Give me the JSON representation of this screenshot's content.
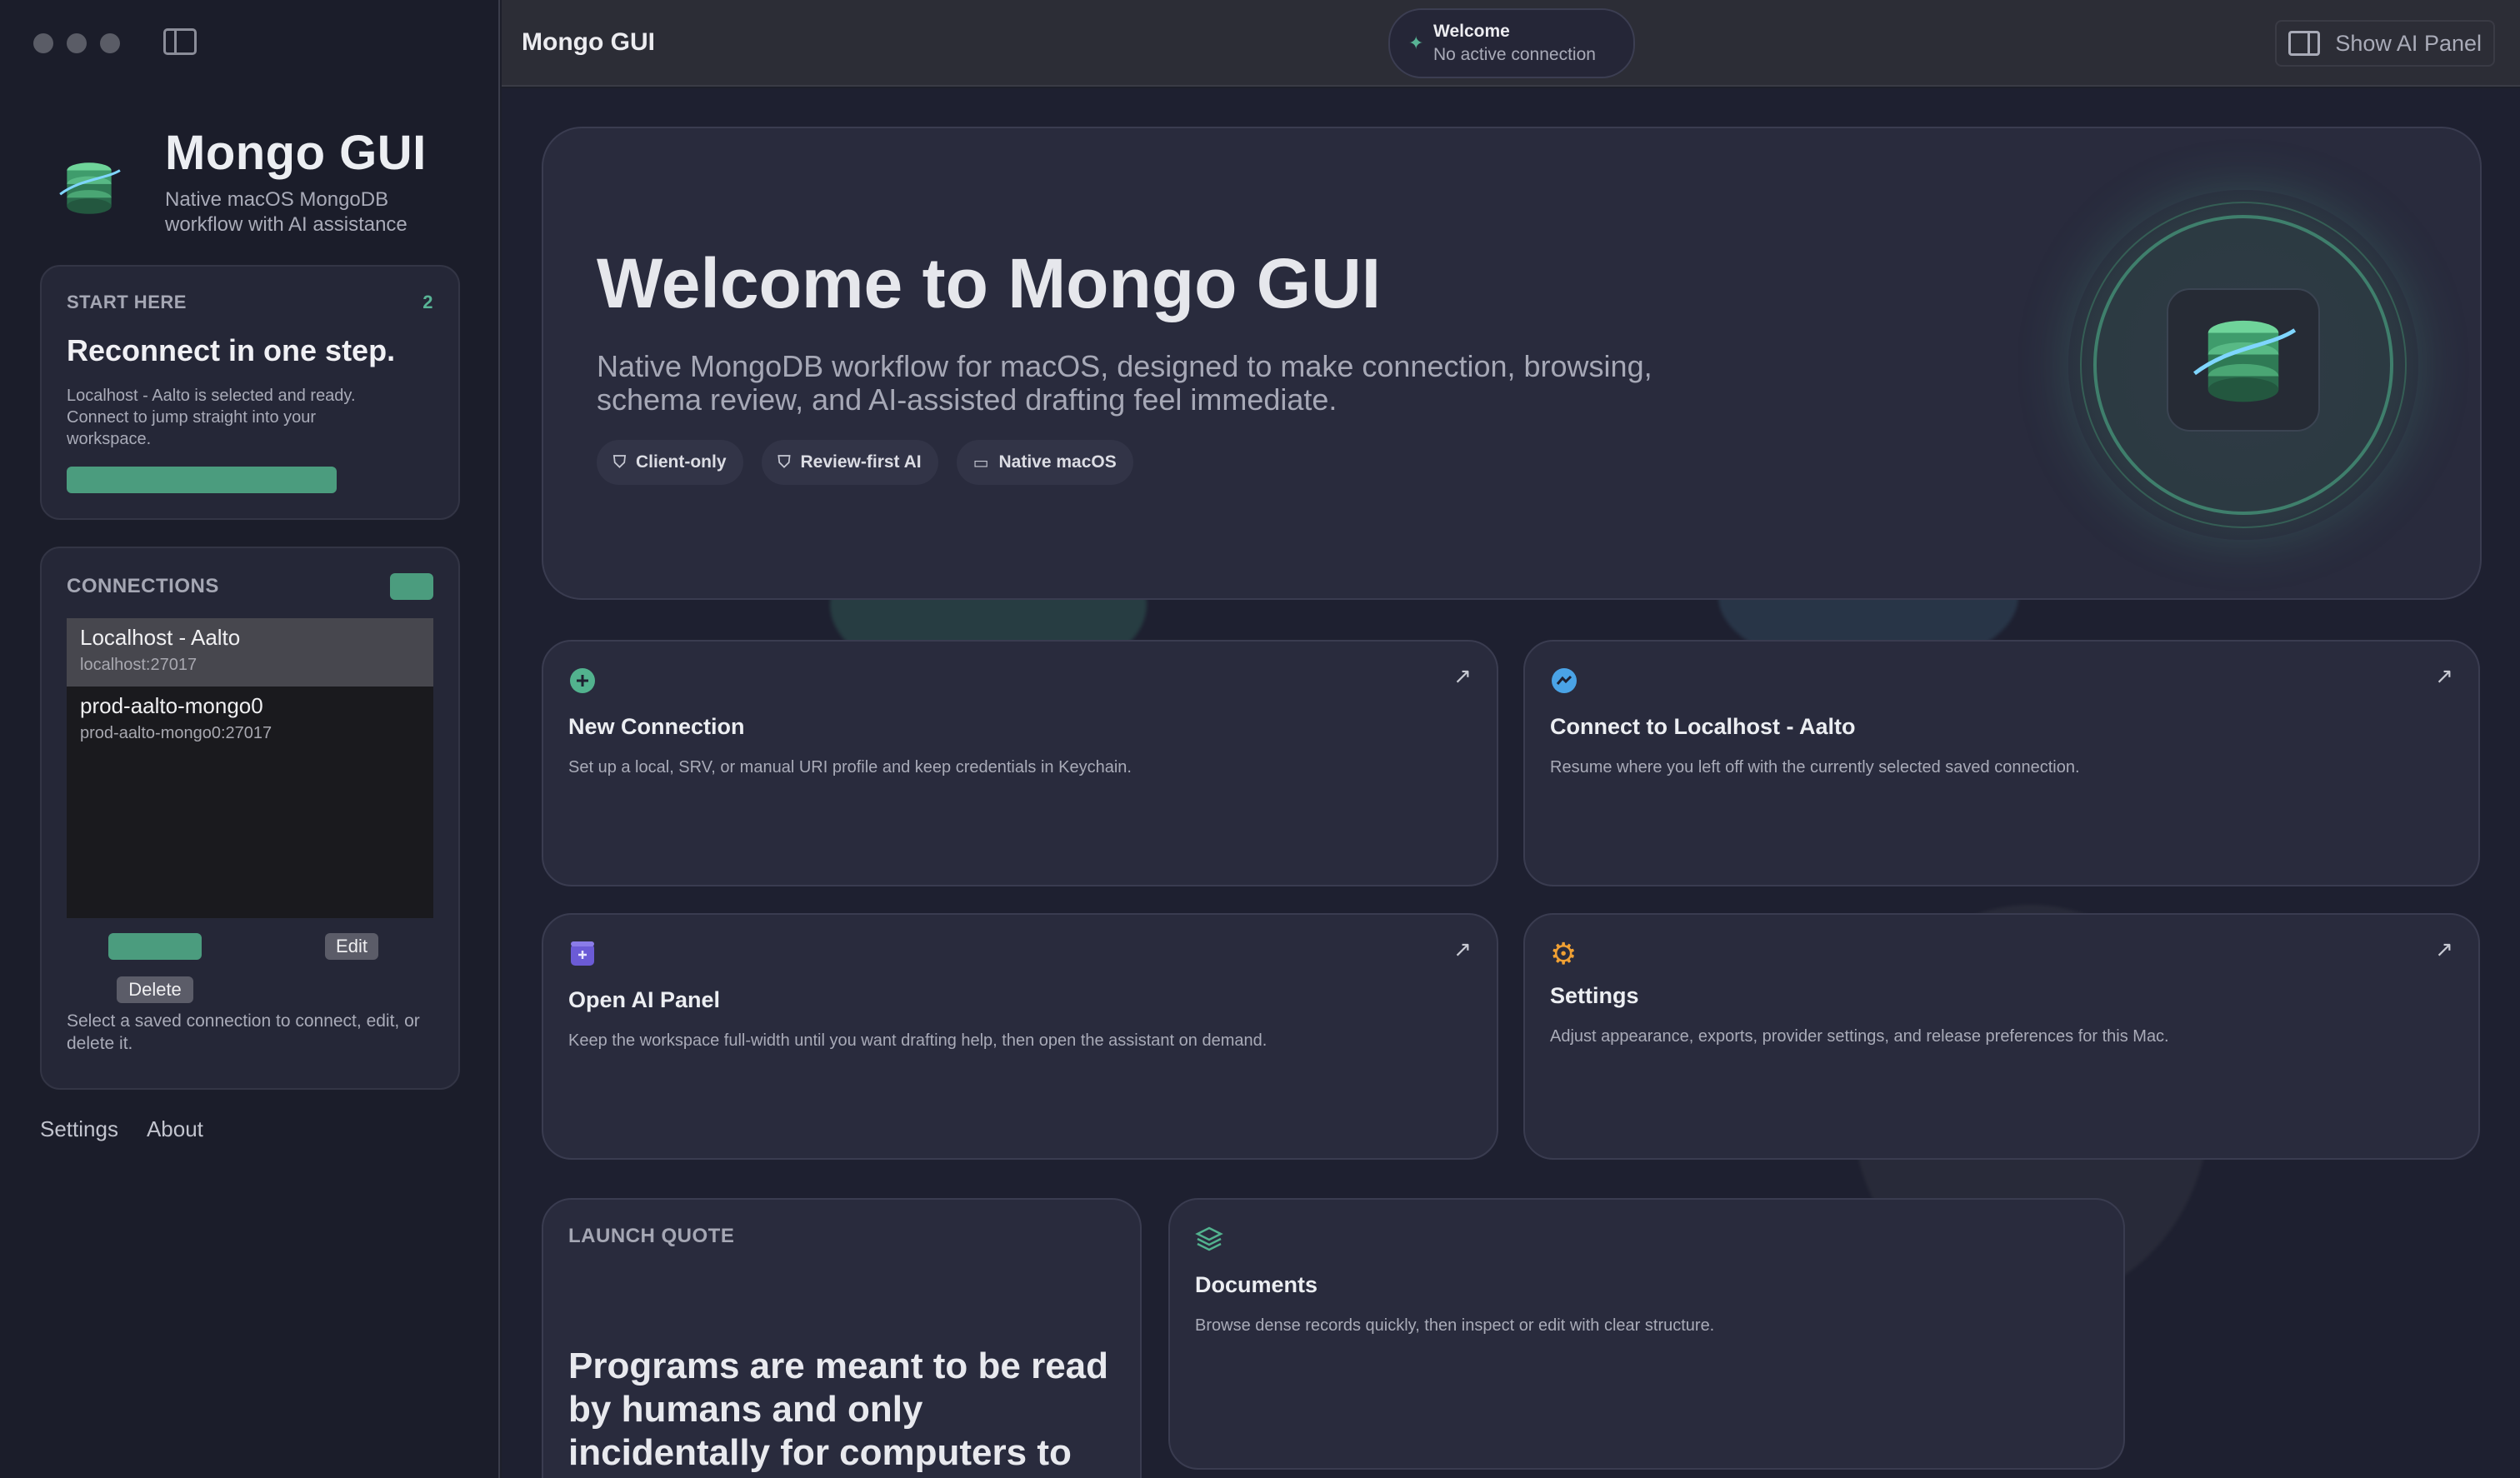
{
  "app": {
    "title": "Mongo GUI",
    "subtitle": "Native macOS MongoDB workflow with AI assistance"
  },
  "topbar": {
    "title": "Mongo GUI",
    "status_title": "Welcome",
    "status_sub": "No active connection",
    "ai_button": "Show AI Panel"
  },
  "start": {
    "label": "START HERE",
    "badge": "2",
    "title": "Reconnect in one step.",
    "body": "Localhost - Aalto is selected and ready. Connect to jump straight into your workspace."
  },
  "connections": {
    "label": "CONNECTIONS",
    "items": [
      {
        "name": "Localhost - Aalto",
        "host": "localhost:27017"
      },
      {
        "name": "prod-aalto-mongo0",
        "host": "prod-aalto-mongo0:27017"
      }
    ],
    "edit": "Edit",
    "delete": "Delete",
    "help": "Select a saved connection to connect, edit, or delete it."
  },
  "sidebar_links": {
    "settings": "Settings",
    "about": "About"
  },
  "hero": {
    "title": "Welcome to Mongo GUI",
    "subtitle": "Native MongoDB workflow for macOS, designed to make connection, browsing, schema review, and AI-assisted drafting feel immediate.",
    "chips": [
      "Client-only",
      "Review-first AI",
      "Native macOS"
    ]
  },
  "tiles": [
    {
      "title": "New Connection",
      "body": "Set up a local, SRV, or manual URI profile and keep credentials in Keychain.",
      "icon": "plus-circle-icon"
    },
    {
      "title": "Connect to Localhost - Aalto",
      "body": "Resume where you left off with the currently selected saved connection.",
      "icon": "link-icon"
    },
    {
      "title": "Open AI Panel",
      "body": "Keep the workspace full-width until you want drafting help, then open the assistant on demand.",
      "icon": "sparkle-panel-icon"
    },
    {
      "title": "Settings",
      "body": "Adjust appearance, exports, provider settings, and release preferences for this Mac.",
      "icon": "gear-icon"
    },
    {
      "title": "Documents",
      "body": "Browse dense records quickly, then inspect or edit with clear structure.",
      "icon": "layers-icon"
    }
  ],
  "quote": {
    "label": "LAUNCH QUOTE",
    "text": "Programs are meant to be read by humans and only incidentally for computers to execute."
  },
  "colors": {
    "accent": "#4b9c7e",
    "background": "#1e2030",
    "card": "#292b3d"
  }
}
